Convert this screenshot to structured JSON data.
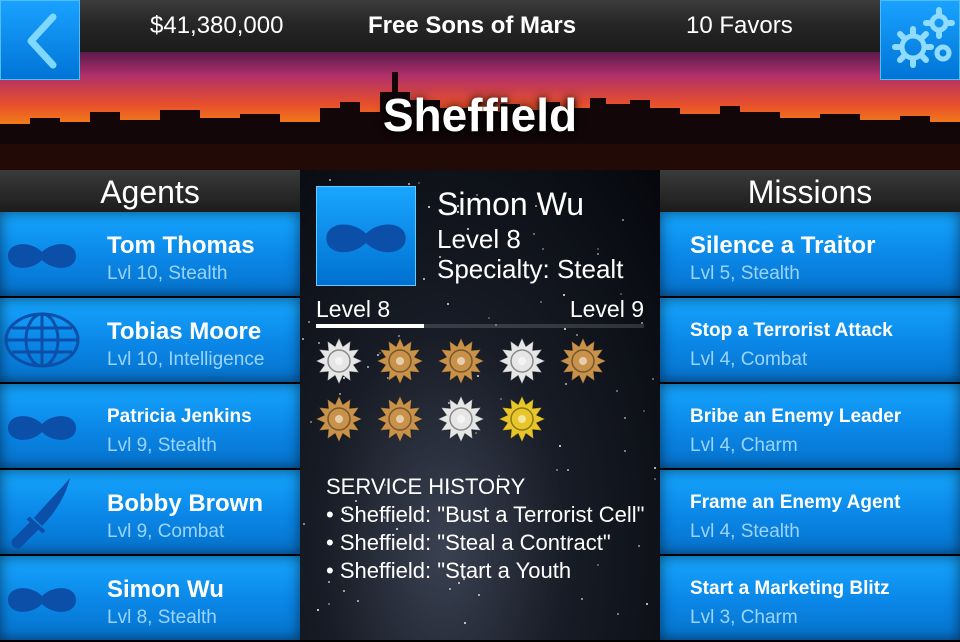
{
  "header": {
    "money": "$41,380,000",
    "team": "Free Sons of Mars",
    "favors": "10 Favors",
    "back_icon": "chevron-left-icon",
    "settings_icon": "gears-icon"
  },
  "city": {
    "name": "Sheffield"
  },
  "agents": {
    "title": "Agents",
    "items": [
      {
        "name": "Tom Thomas",
        "detail": "Lvl 10, Stealth",
        "icon": "mask-icon"
      },
      {
        "name": "Tobias Moore",
        "detail": "Lvl 10, Intelligence",
        "icon": "globe-icon"
      },
      {
        "name": "Patricia Jenkins",
        "detail": "Lvl 9, Stealth",
        "icon": "mask-icon"
      },
      {
        "name": "Bobby Brown",
        "detail": "Lvl 9, Combat",
        "icon": "knife-icon"
      },
      {
        "name": "Simon Wu",
        "detail": "Lvl 8, Stealth",
        "icon": "mask-icon"
      }
    ]
  },
  "missions": {
    "title": "Missions",
    "items": [
      {
        "name": "Silence a Traitor",
        "detail": "Lvl 5, Stealth"
      },
      {
        "name": "Stop a Terrorist Attack",
        "detail": "Lvl 4, Combat"
      },
      {
        "name": "Bribe an Enemy Leader",
        "detail": "Lvl 4, Charm"
      },
      {
        "name": "Frame an Enemy Agent",
        "detail": "Lvl 4, Stealth"
      },
      {
        "name": "Start a Marketing Blitz",
        "detail": "Lvl 3, Charm"
      }
    ]
  },
  "selected_agent": {
    "name": "Simon Wu",
    "level": "Level 8",
    "specialty": "Specialty: Stealt",
    "icon": "mask-icon",
    "xp_from": "Level 8",
    "xp_to": "Level 9",
    "xp_progress": 0.33,
    "medals": [
      {
        "icon": "medal-stars-icon",
        "color": "#e6e6e6"
      },
      {
        "icon": "medal-crown-icon",
        "color": "#c8924a"
      },
      {
        "icon": "medal-stripes-icon",
        "color": "#c8924a"
      },
      {
        "icon": "medal-90-icon",
        "color": "#e6e6e6"
      },
      {
        "icon": "medal-figure-icon",
        "color": "#c8924a"
      },
      {
        "icon": "medal-bulb-icon",
        "color": "#c8924a"
      },
      {
        "icon": "medal-wreath-icon",
        "color": "#c8924a"
      },
      {
        "icon": "medal-lock-icon",
        "color": "#e6e6e6"
      },
      {
        "icon": "medal-globe-icon",
        "color": "#e8c62a"
      }
    ],
    "history_title": "SERVICE HISTORY",
    "history": [
      "• Sheffield: \"Bust a Terrorist Cell\"",
      "• Sheffield: \"Steal a Contract\"",
      "• Sheffield: \"Start a Youth"
    ]
  },
  "colors": {
    "accent": "#0a86e6",
    "accent_light": "#16a6ff",
    "sub_text": "#9bd4ff"
  }
}
